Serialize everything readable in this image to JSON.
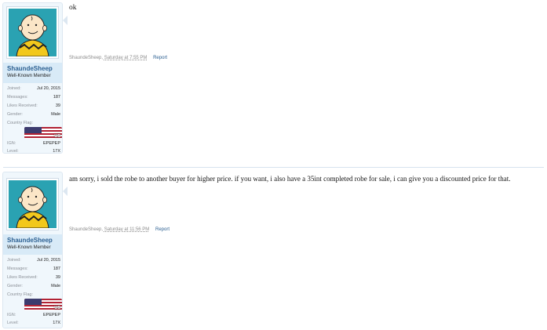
{
  "posts": [
    {
      "user": {
        "name": "ShaundeSheep",
        "title": "Well-Known Member",
        "avatar_icon": "charlie-brown-avatar",
        "stats": [
          {
            "label": "Joined:",
            "value": "Jul 20, 2015"
          },
          {
            "label": "Messages:",
            "value": "187"
          },
          {
            "label": "Likes Received:",
            "value": "39"
          },
          {
            "label": "Gender:",
            "value": "Male"
          },
          {
            "label": "Country Flag:",
            "value": "US"
          },
          {
            "label": "IGN:",
            "value": "EPEPEP"
          },
          {
            "label": "Level:",
            "value": "17X"
          }
        ]
      },
      "message": "ok",
      "meta": {
        "author": "ShaundeSheep,",
        "date": "Saturday at 7:55 PM",
        "report": "Report"
      }
    },
    {
      "user": {
        "name": "ShaundeSheep",
        "title": "Well-Known Member",
        "avatar_icon": "charlie-brown-avatar",
        "stats": [
          {
            "label": "Joined:",
            "value": "Jul 20, 2015"
          },
          {
            "label": "Messages:",
            "value": "187"
          },
          {
            "label": "Likes Received:",
            "value": "39"
          },
          {
            "label": "Gender:",
            "value": "Male"
          },
          {
            "label": "Country Flag:",
            "value": "US"
          },
          {
            "label": "IGN:",
            "value": "EPEPEP"
          },
          {
            "label": "Level:",
            "value": "17X"
          }
        ]
      },
      "message": "am sorry, i sold the robe to another buyer for higher price. if you want, i also have a 35int completed robe for sale, i can give you a discounted price for that.",
      "meta": {
        "author": "ShaundeSheep,",
        "date": "Saturday at 11:56 PM",
        "report": "Report"
      }
    }
  ]
}
